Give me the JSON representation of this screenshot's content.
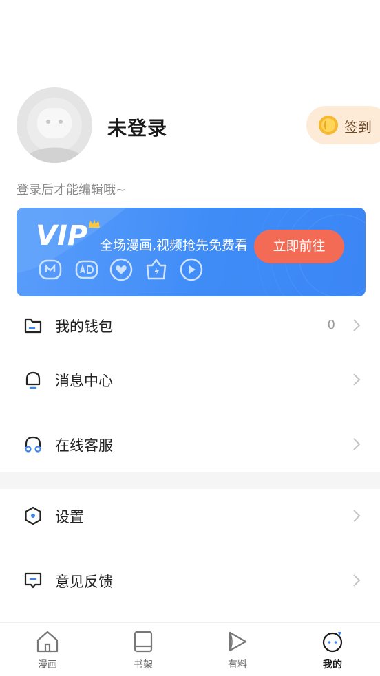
{
  "profile": {
    "username": "未登录",
    "signin_label": "签到",
    "hint": "登录后才能编辑哦~"
  },
  "vip_banner": {
    "logo": "VIP",
    "slogan": "全场漫画,视频抢先免费看",
    "button": "立即前往",
    "perk_icons": [
      "manga-icon",
      "ad-free-icon",
      "heart-icon",
      "flash-icon",
      "play-icon"
    ],
    "colors": {
      "banner": "#4a92f8",
      "button": "#f36b55"
    }
  },
  "menu": {
    "wallet": {
      "label": "我的钱包",
      "value": "0",
      "icon": "wallet-icon"
    },
    "messages": {
      "label": "消息中心",
      "icon": "bell-icon"
    },
    "service": {
      "label": "在线客服",
      "icon": "headset-icon"
    },
    "settings": {
      "label": "设置",
      "icon": "hexagon-settings-icon"
    },
    "feedback": {
      "label": "意见反馈",
      "icon": "feedback-icon"
    }
  },
  "tabbar": {
    "tabs": [
      {
        "label": "漫画",
        "icon": "home-icon"
      },
      {
        "label": "书架",
        "icon": "bookshelf-icon"
      },
      {
        "label": "有料",
        "icon": "play-tab-icon"
      },
      {
        "label": "我的",
        "icon": "mine-face-icon",
        "active": true
      }
    ]
  },
  "theme": {
    "accent": "#3a86f4",
    "text": "#222222",
    "muted": "#999999"
  }
}
